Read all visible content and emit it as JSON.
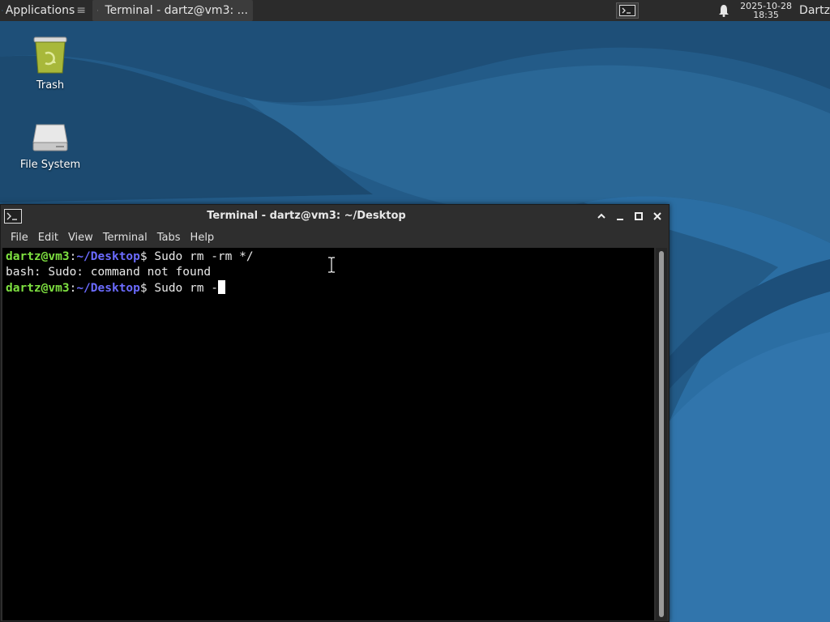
{
  "panel": {
    "apps_label": "Applications",
    "task_title": "Terminal - dartz@vm3: ...",
    "clock_date": "2025-10-28",
    "clock_time": "18:35",
    "user": "Dartz"
  },
  "desktop": {
    "icons": [
      {
        "label": "Trash",
        "icon": "trash-icon"
      },
      {
        "label": "File System",
        "icon": "drive-icon"
      }
    ]
  },
  "terminal": {
    "title": "Terminal - dartz@vm3: ~/Desktop",
    "menu": [
      "File",
      "Edit",
      "View",
      "Terminal",
      "Tabs",
      "Help"
    ],
    "lines": [
      {
        "user": "dartz@vm3",
        "path": "~/Desktop",
        "cmd": "Sudo rm -rm */"
      },
      {
        "output": "bash: Sudo: command not found"
      },
      {
        "user": "dartz@vm3",
        "path": "~/Desktop",
        "cmd": "Sudo rm -"
      }
    ]
  },
  "colors": {
    "prompt_user": "#7ee040",
    "prompt_path": "#6b6bff",
    "panel_bg": "#2b2b2b",
    "desktop_bg": "#1f5a86"
  }
}
